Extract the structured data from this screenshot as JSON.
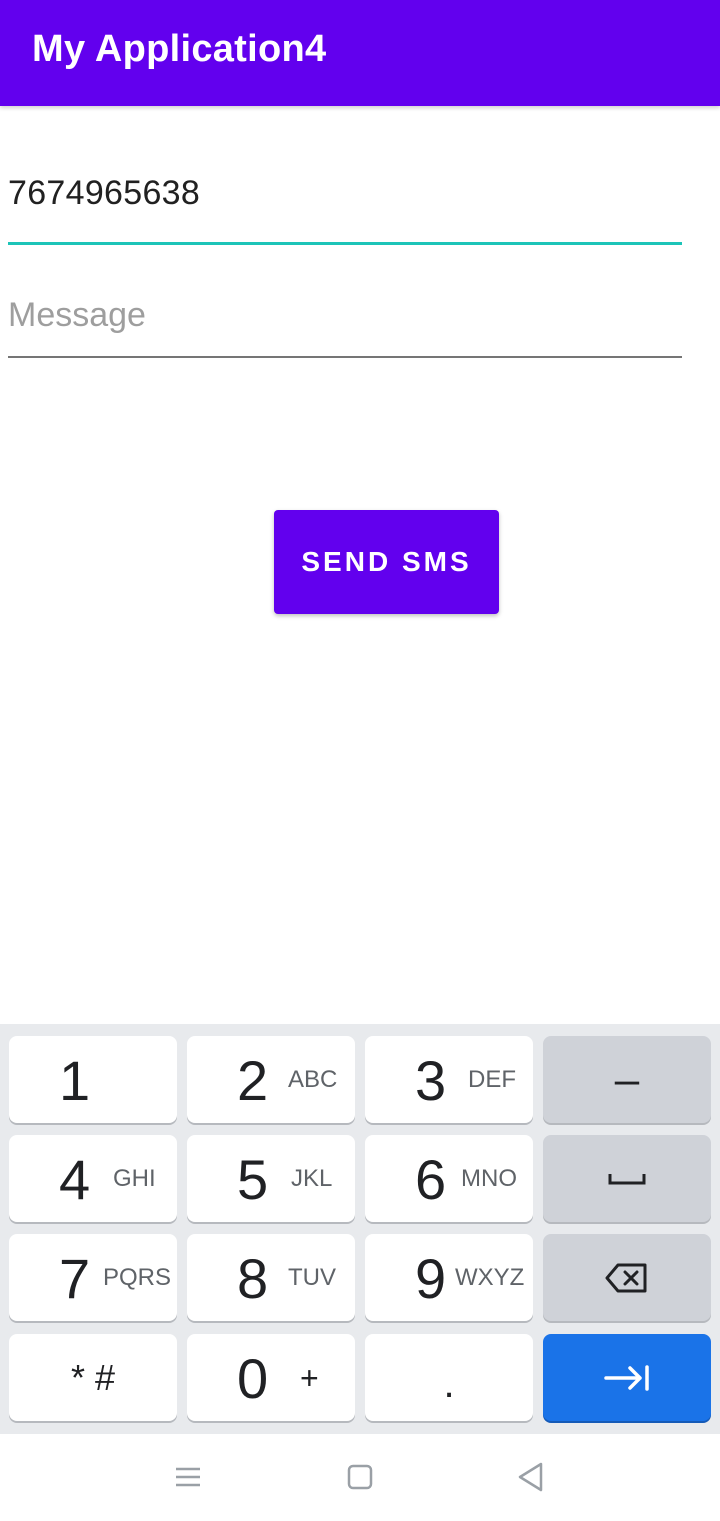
{
  "app": {
    "title": "My Application4"
  },
  "form": {
    "phone_value": "7674965638",
    "message_placeholder": "Message",
    "send_label": "SEND SMS"
  },
  "keyboard": {
    "keys": [
      {
        "num": "1",
        "letters": ""
      },
      {
        "num": "2",
        "letters": "ABC"
      },
      {
        "num": "3",
        "letters": "DEF"
      },
      {
        "num": "4",
        "letters": "GHI"
      },
      {
        "num": "5",
        "letters": "JKL"
      },
      {
        "num": "6",
        "letters": "MNO"
      },
      {
        "num": "7",
        "letters": "PQRS"
      },
      {
        "num": "8",
        "letters": "TUV"
      },
      {
        "num": "9",
        "letters": "WXYZ"
      },
      {
        "num": "0",
        "letters": "+"
      }
    ],
    "symbols": "* #",
    "dot": ".",
    "minus": "–",
    "space_icon": "space-icon",
    "backspace_icon": "backspace-icon",
    "next_icon": "tab-next-icon",
    "accent_color": "#1a73e8"
  },
  "navbar": {
    "icons": [
      "menu-icon",
      "home-square-icon",
      "back-triangle-icon"
    ]
  },
  "colors": {
    "primary": "#6200ee",
    "focus_underline": "#1cc4b8"
  }
}
